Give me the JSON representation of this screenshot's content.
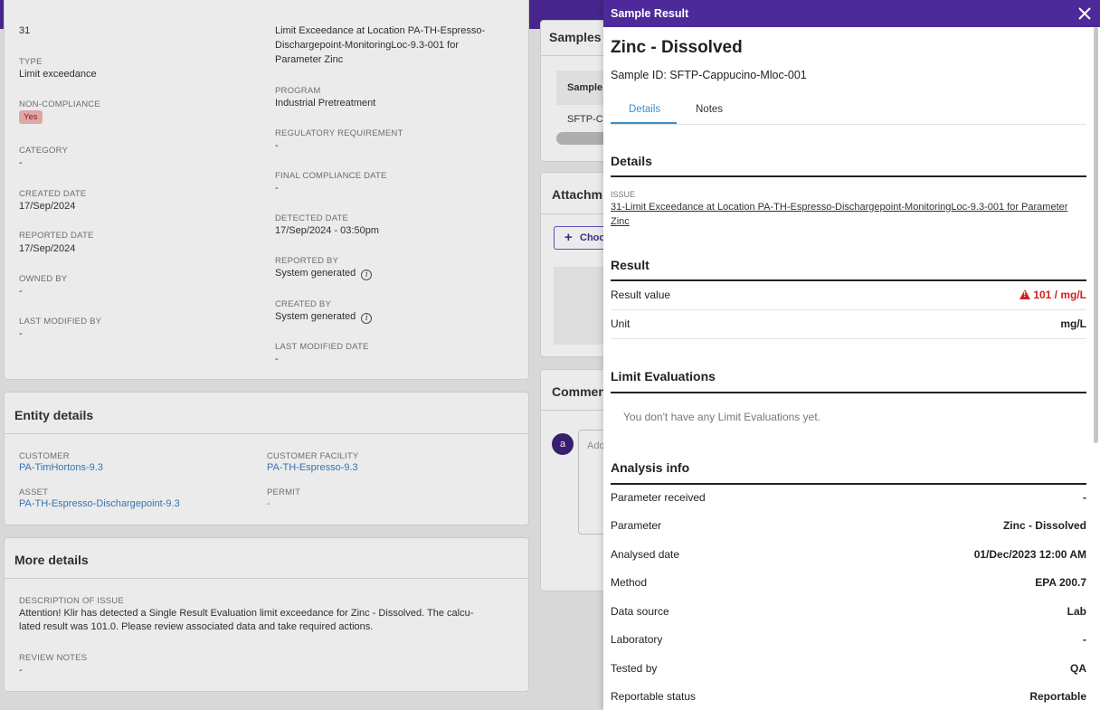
{
  "issue": {
    "id": "31",
    "title_lines": [
      "Limit Exceedance at Location PA-TH-Espresso-",
      "Dischargepoint-MonitoringLoc-9.3-001 for",
      "Parameter Zinc"
    ],
    "type_label": "TYPE",
    "type_value": "Limit exceedance",
    "noncompliance_label": "NON-COMPLIANCE",
    "noncompliance_value": "Yes",
    "category_label": "CATEGORY",
    "category_value": "-",
    "created_date_label": "CREATED DATE",
    "created_date_value": "17/Sep/2024",
    "reported_date_label": "REPORTED DATE",
    "reported_date_value": "17/Sep/2024",
    "owned_by_label": "OWNED BY",
    "owned_by_value": "-",
    "last_modified_by_label": "LAST MODIFIED BY",
    "last_modified_by_value": "-",
    "program_label": "PROGRAM",
    "program_value": "Industrial Pretreatment",
    "reg_req_label": "REGULATORY REQUIREMENT",
    "reg_req_value": "-",
    "final_compliance_label": "FINAL COMPLIANCE DATE",
    "final_compliance_value": "-",
    "detected_date_label": "DETECTED DATE",
    "detected_date_value": "17/Sep/2024 - 03:50pm",
    "reported_by_label": "REPORTED BY",
    "reported_by_value": "System generated",
    "created_by_label": "CREATED BY",
    "created_by_value": "System generated",
    "last_modified_date_label": "LAST MODIFIED DATE",
    "last_modified_date_value": "-"
  },
  "entity": {
    "title": "Entity details",
    "customer_label": "CUSTOMER",
    "customer_value": "PA-TimHortons-9.3",
    "facility_label": "CUSTOMER FACILITY",
    "facility_value": "PA-TH-Espresso-9.3",
    "asset_label": "ASSET",
    "asset_value": "PA-TH-Espresso-Dischargepoint-9.3",
    "permit_label": "PERMIT",
    "permit_value": "-"
  },
  "more": {
    "title": "More details",
    "desc_label": "DESCRIPTION OF ISSUE",
    "desc_lines": [
      "Attention! Klir has detected a Single Result Evaluation limit exceedance for Zinc - Dissolved. The calcu-",
      "lated result was 101.0. Please review associated data and take required actions."
    ],
    "review_label": "REVIEW NOTES",
    "review_value": "-"
  },
  "right_col": {
    "samples_title": "Samples",
    "samples_header": "Sample",
    "samples_row": "SFTP-Ca",
    "attachments_title": "Attachm",
    "choose_label": "Choo",
    "comments_title": "Commen",
    "avatar_letter": "a",
    "comment_placeholder": "Add"
  },
  "drawer": {
    "header_title": "Sample Result",
    "close_icon": "close-icon",
    "title": "Zinc - Dissolved",
    "sample_id": "Sample ID: SFTP-Cappucino-Mloc-001",
    "tabs": [
      "Details",
      "Notes"
    ],
    "details_title": "Details",
    "issue_label": "ISSUE",
    "issue_link_lines": [
      "31-Limit Exceedance at Location PA-TH-Espresso-Dischargepoint-MonitoringLoc-9.3-001 for Parameter",
      "Zinc"
    ],
    "result_title": "Result",
    "result_value_label": "Result value",
    "result_value": "101 / mg/L",
    "unit_label": "Unit",
    "unit_value": "mg/L",
    "limit_title": "Limit Evaluations",
    "limit_empty": "You don't have any Limit Evaluations yet.",
    "analysis_title": "Analysis info",
    "analysis_rows": [
      {
        "k": "Parameter received",
        "v": "-"
      },
      {
        "k": "Parameter",
        "v": "Zinc - Dissolved"
      },
      {
        "k": "Analysed date",
        "v": "01/Dec/2023 12:00 AM"
      },
      {
        "k": "Method",
        "v": "EPA 200.7"
      },
      {
        "k": "Data source",
        "v": "Lab"
      },
      {
        "k": "Laboratory",
        "v": "-"
      },
      {
        "k": "Tested by",
        "v": "QA"
      },
      {
        "k": "Reportable status",
        "v": "Reportable"
      }
    ],
    "colors": {
      "header": "#4d2a9a",
      "accent": "#3a8fd0",
      "alert": "#d42020"
    }
  }
}
